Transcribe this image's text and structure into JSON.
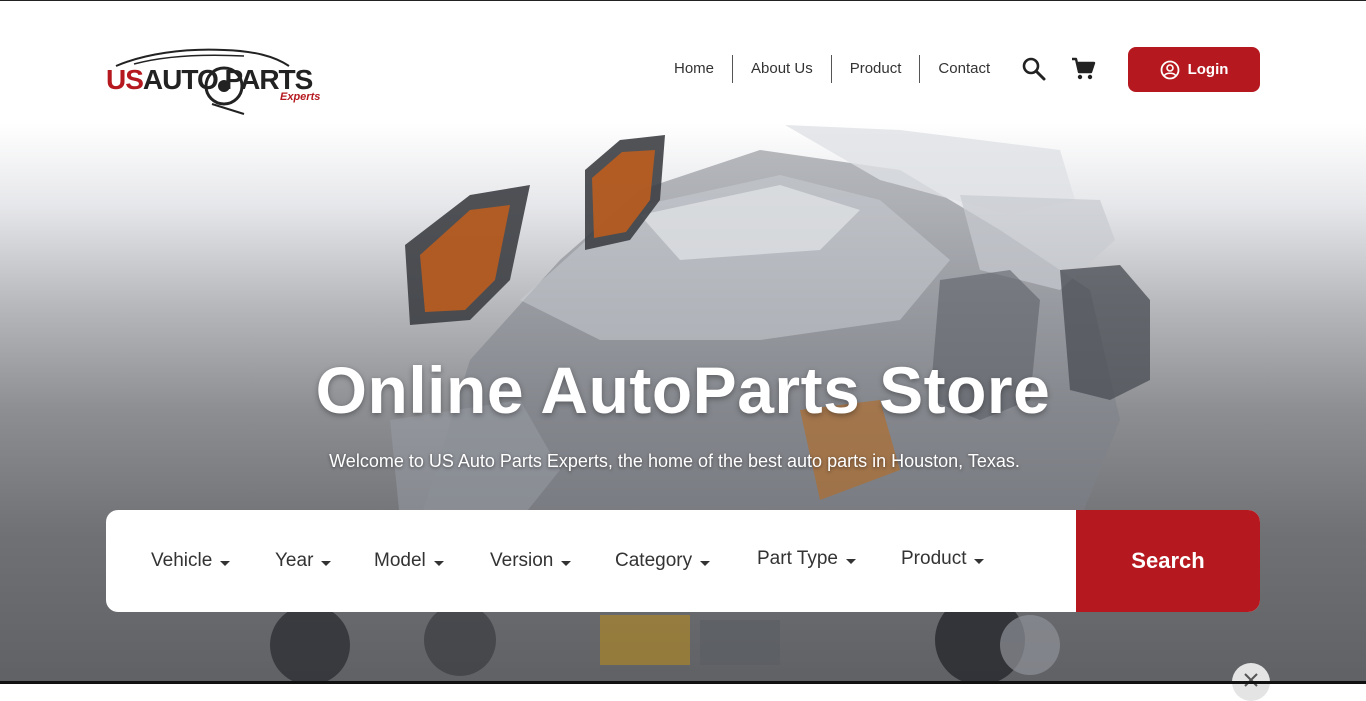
{
  "brand": {
    "logo_main_us": "US",
    "logo_main_rest": "AUTO PARTS",
    "logo_sub": "Experts",
    "accent_color": "#b5191f"
  },
  "nav": {
    "items": [
      {
        "label": "Home"
      },
      {
        "label": "About Us"
      },
      {
        "label": "Product"
      },
      {
        "label": "Contact"
      }
    ],
    "search_icon": "search-icon",
    "cart_icon": "cart-icon",
    "login_label": "Login",
    "login_icon": "user-circle-icon"
  },
  "hero": {
    "title": "Online AutoParts Store",
    "subtitle": "Welcome to US Auto Parts Experts, the home of the best auto parts in Houston, Texas."
  },
  "search": {
    "filters": [
      {
        "label": "Vehicle"
      },
      {
        "label": "Year"
      },
      {
        "label": "Model"
      },
      {
        "label": "Version"
      },
      {
        "label": "Category"
      },
      {
        "label": "Part Type"
      },
      {
        "label": "Product"
      }
    ],
    "button_label": "Search"
  }
}
